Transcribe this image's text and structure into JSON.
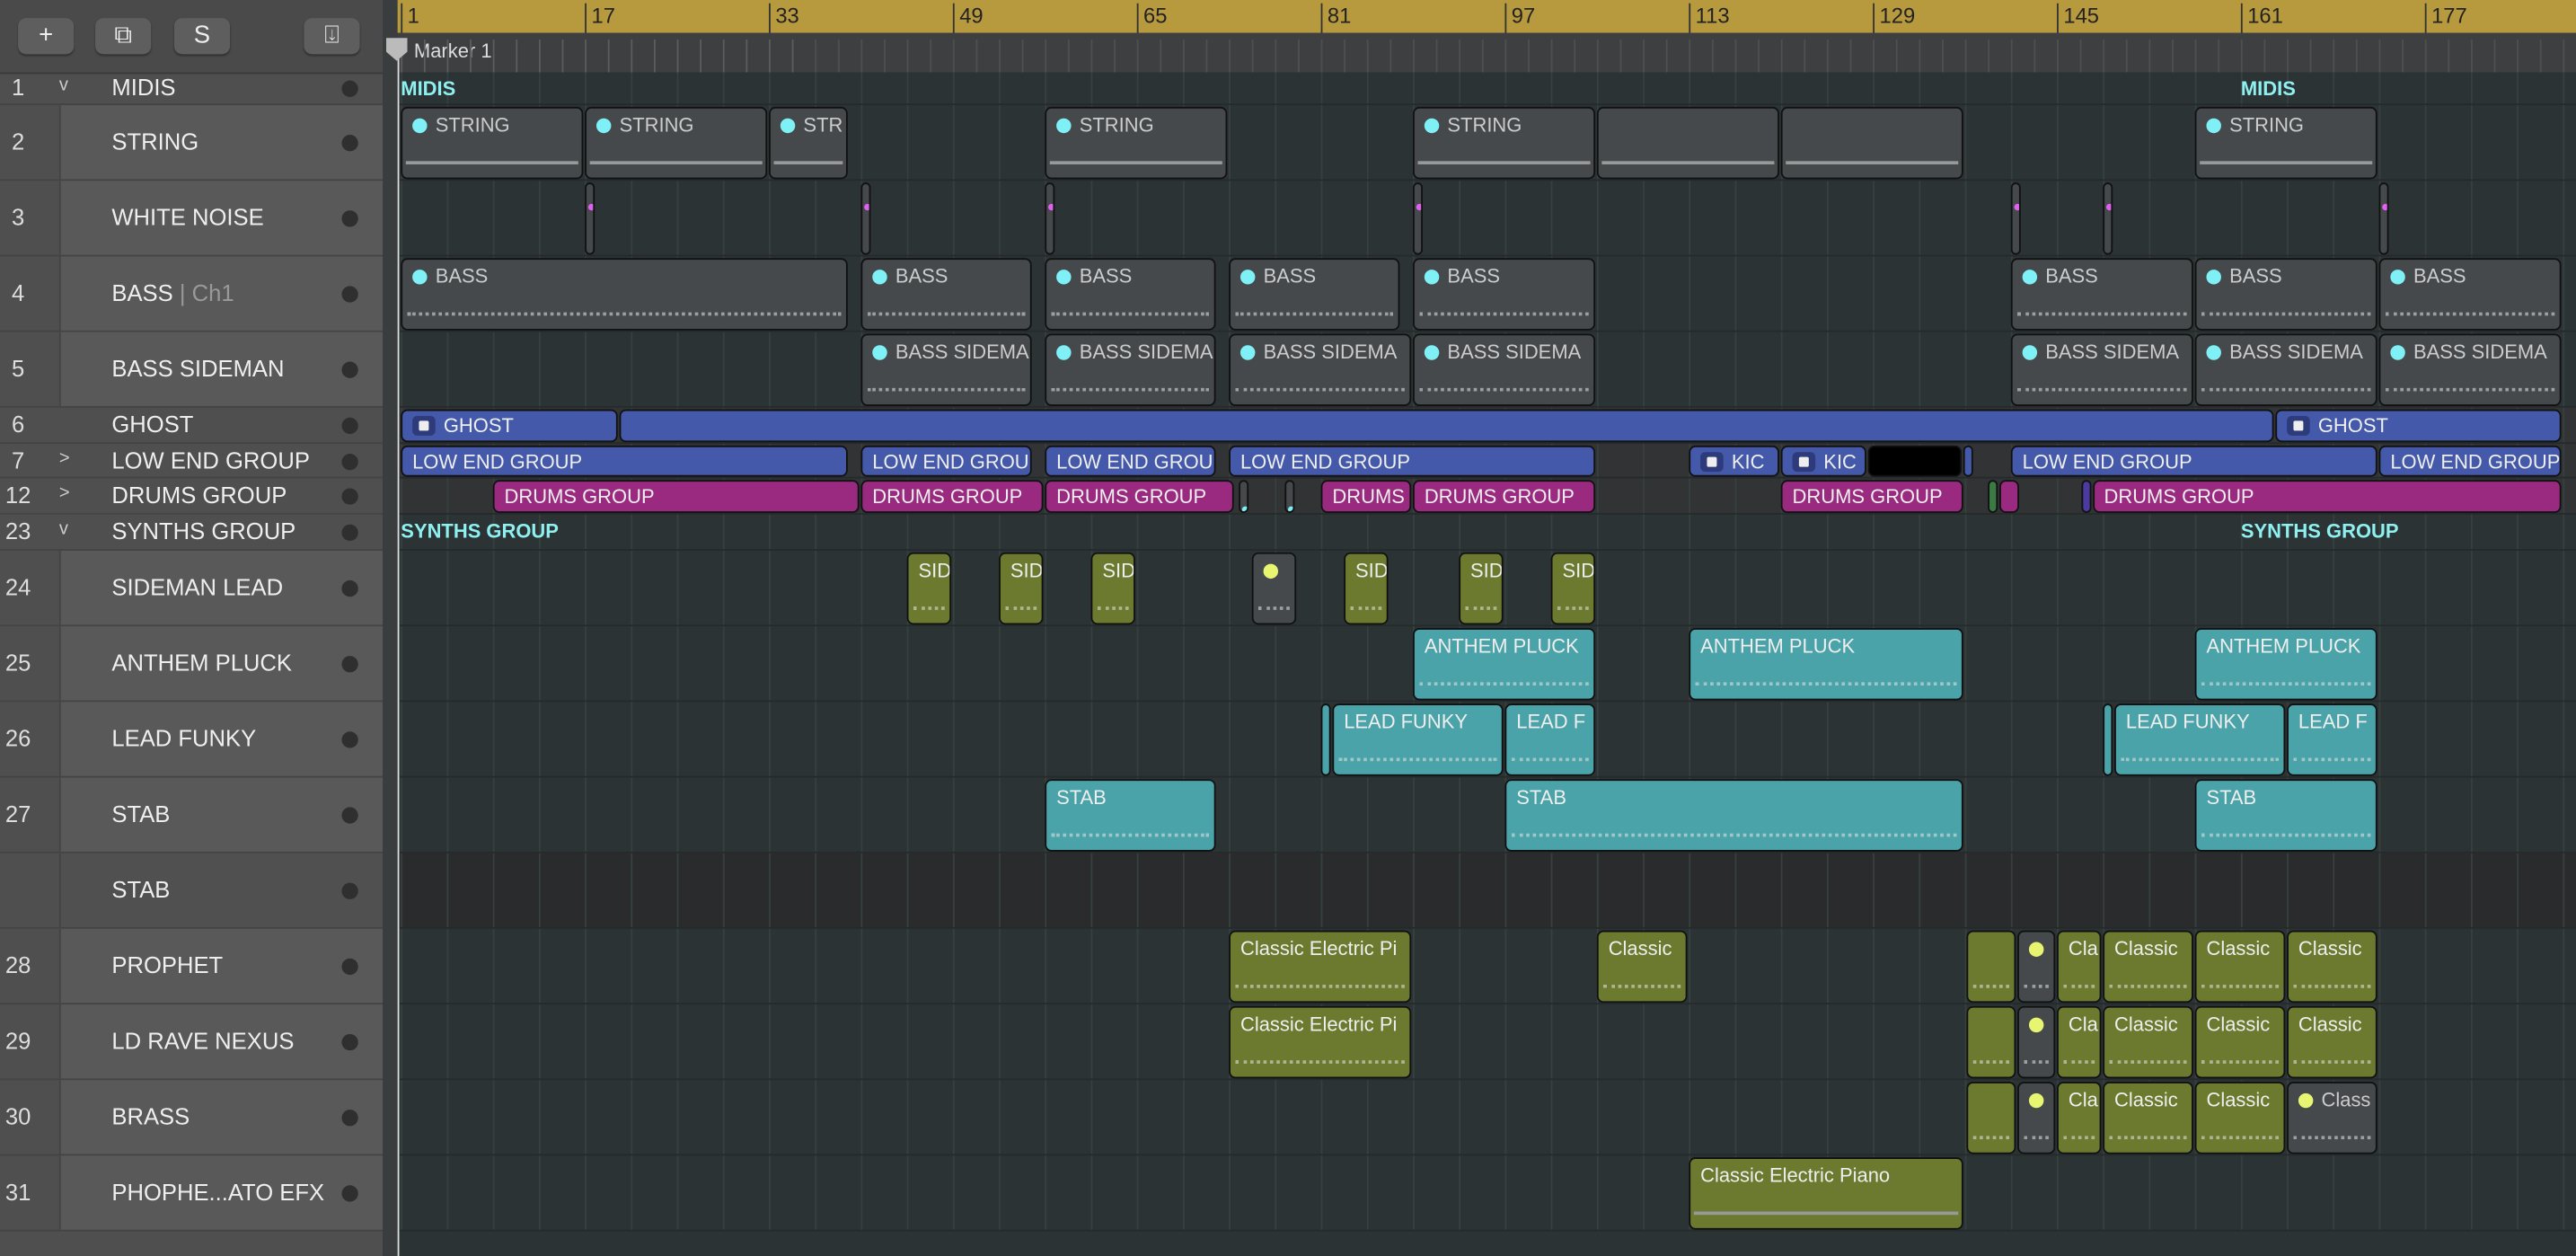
{
  "toolbar": {
    "add_label": "+",
    "duplicate_icon": "duplicate-track-icon",
    "solo_label": "S",
    "download_icon": "download-icon"
  },
  "ruler": {
    "bars": [
      "1",
      "17",
      "33",
      "49",
      "65",
      "81",
      "97",
      "113",
      "129",
      "145",
      "161",
      "177"
    ],
    "marker": "Marker 1"
  },
  "colors": {
    "teal": "#4aa3a8",
    "olive": "#6b7a2e",
    "blue": "#4459a9",
    "magenta": "#9a2a80",
    "gray": "#45494c",
    "black": "#000000",
    "green": "#3c7a45",
    "purple": "#4b3aa0",
    "cyan_dot": "#7ff0f5",
    "yellow_dot": "#e8f570",
    "pink_dot": "#e060f0"
  },
  "tracks": [
    {
      "num": "1",
      "name": "MIDIS",
      "chev": "v",
      "type": "group"
    },
    {
      "num": "2",
      "name": "STRING"
    },
    {
      "num": "3",
      "name": "WHITE NOISE"
    },
    {
      "num": "4",
      "name": "BASS",
      "sub": "| Ch1"
    },
    {
      "num": "5",
      "name": "BASS SIDEMAN"
    },
    {
      "num": "6",
      "name": "GHOST",
      "type": "small"
    },
    {
      "num": "7",
      "name": "LOW END GROUP",
      "chev": ">",
      "type": "small"
    },
    {
      "num": "12",
      "name": "DRUMS GROUP",
      "chev": ">",
      "type": "small"
    },
    {
      "num": "23",
      "name": "SYNTHS GROUP",
      "chev": "v",
      "type": "group"
    },
    {
      "num": "24",
      "name": "SIDEMAN LEAD"
    },
    {
      "num": "25",
      "name": "ANTHEM PLUCK"
    },
    {
      "num": "26",
      "name": "LEAD FUNKY"
    },
    {
      "num": "27",
      "name": "STAB"
    },
    {
      "num": "",
      "name": "STAB",
      "dark": true
    },
    {
      "num": "28",
      "name": "PROPHET"
    },
    {
      "num": "29",
      "name": "LD RAVE NEXUS"
    },
    {
      "num": "30",
      "name": "BRASS"
    },
    {
      "num": "31",
      "name": "PHOPHE...ATO EFX"
    }
  ],
  "group_labels": [
    {
      "lane": 0,
      "bar": 1,
      "text": "MIDIS"
    },
    {
      "lane": 0,
      "bar": 161,
      "text": "MIDIS"
    },
    {
      "lane": 8,
      "bar": 1,
      "text": "SYNTHS GROUP"
    },
    {
      "lane": 8,
      "bar": 161,
      "text": "SYNTHS GROUP"
    }
  ],
  "regions": [
    {
      "lane": 1,
      "items": [
        [
          1,
          17,
          "STRING",
          "gray",
          "cd"
        ],
        [
          17,
          33,
          "STRING",
          "gray",
          "cd"
        ],
        [
          33,
          40,
          "STR",
          "gray",
          "cd"
        ],
        [
          57,
          73,
          "STRING",
          "gray",
          "cd"
        ],
        [
          89,
          105,
          "STRING",
          "gray",
          "cd"
        ],
        [
          105,
          121,
          "",
          "gray",
          "l"
        ],
        [
          121,
          137,
          "",
          "gray",
          "l"
        ],
        [
          157,
          173,
          "STRING",
          "gray",
          "cd"
        ]
      ]
    },
    {
      "lane": 2,
      "items": [
        [
          17,
          18,
          "",
          "gray",
          "p"
        ],
        [
          41,
          42,
          "",
          "gray",
          "p"
        ],
        [
          57,
          58,
          "",
          "gray",
          "p"
        ],
        [
          89,
          90,
          "",
          "gray",
          "p"
        ],
        [
          141,
          142,
          "",
          "gray",
          "p"
        ],
        [
          149,
          150,
          "",
          "gray",
          "p"
        ],
        [
          173,
          174,
          "",
          "gray",
          "p"
        ]
      ]
    },
    {
      "lane": 3,
      "items": [
        [
          1,
          40,
          "BASS",
          "gray",
          "cn"
        ],
        [
          41,
          56,
          "BASS",
          "gray",
          "cn"
        ],
        [
          57,
          72,
          "BASS",
          "gray",
          "cn"
        ],
        [
          73,
          88,
          "BASS",
          "gray",
          "cn"
        ],
        [
          89,
          105,
          "BASS",
          "gray",
          "cn"
        ],
        [
          141,
          157,
          "BASS",
          "gray",
          "cn"
        ],
        [
          157,
          173,
          "BASS",
          "gray",
          "cn"
        ],
        [
          173,
          189,
          "BASS",
          "gray",
          "cn"
        ]
      ]
    },
    {
      "lane": 4,
      "items": [
        [
          41,
          56,
          "BASS SIDEMA",
          "gray",
          "cn"
        ],
        [
          57,
          72,
          "BASS SIDEMA",
          "gray",
          "cn"
        ],
        [
          73,
          89,
          "BASS SIDEMA",
          "gray",
          "cn"
        ],
        [
          89,
          105,
          "BASS SIDEMA",
          "gray",
          "cn"
        ],
        [
          141,
          157,
          "BASS SIDEMA",
          "gray",
          "cn"
        ],
        [
          157,
          173,
          "BASS SIDEMA",
          "gray",
          "cn"
        ],
        [
          173,
          189,
          "BASS SIDEMA",
          "gray",
          "cn"
        ]
      ]
    },
    {
      "lane": 5,
      "items": [
        [
          1,
          20,
          "GHOST",
          "blue",
          "f"
        ],
        [
          20,
          164,
          "",
          "blue",
          ""
        ],
        [
          164,
          189,
          "GHOST",
          "blue",
          "f"
        ]
      ]
    },
    {
      "lane": 6,
      "items": [
        [
          1,
          40,
          "LOW END GROUP",
          "blue",
          ""
        ],
        [
          41,
          56,
          "LOW END GROU",
          "blue",
          ""
        ],
        [
          57,
          72,
          "LOW END GROU",
          "blue",
          ""
        ],
        [
          73,
          105,
          "LOW END GROUP",
          "blue",
          ""
        ],
        [
          113,
          121,
          "KIC",
          "blue",
          "f"
        ],
        [
          121,
          128.6,
          "KIC",
          "blue",
          "f"
        ],
        [
          128.6,
          136.8,
          "",
          "black",
          ""
        ],
        [
          136.8,
          137.8,
          "",
          "blue",
          ""
        ],
        [
          141,
          173,
          "LOW END GROUP",
          "blue",
          ""
        ],
        [
          173,
          189,
          "LOW END GROUP",
          "blue",
          ""
        ]
      ]
    },
    {
      "lane": 7,
      "items": [
        [
          9,
          41,
          "DRUMS GROUP",
          "magenta",
          ""
        ],
        [
          41,
          57,
          "DRUMS GROUP",
          "magenta",
          ""
        ],
        [
          57,
          73.6,
          "DRUMS GROUP",
          "magenta",
          ""
        ],
        [
          73.9,
          74.9,
          "",
          "gray",
          "q"
        ],
        [
          77.9,
          78.9,
          "",
          "gray",
          "q"
        ],
        [
          81,
          89,
          "DRUMS",
          "magenta",
          ""
        ],
        [
          89,
          105,
          "DRUMS GROUP",
          "magenta",
          ""
        ],
        [
          121,
          137,
          "DRUMS GROUP",
          "magenta",
          ""
        ],
        [
          139,
          140,
          "",
          "green",
          ""
        ],
        [
          140,
          141.9,
          "",
          "magenta",
          ""
        ],
        [
          147.2,
          148.1,
          "",
          "purple",
          ""
        ],
        [
          148.1,
          189,
          "DRUMS GROUP",
          "magenta",
          ""
        ]
      ]
    },
    {
      "lane": 9,
      "items": [
        [
          45,
          49,
          "SID",
          "olive",
          "n"
        ],
        [
          53,
          57,
          "SID",
          "olive",
          "n"
        ],
        [
          61,
          65,
          "SID",
          "olive",
          "n"
        ],
        [
          75,
          79,
          "",
          "gray",
          "yn"
        ],
        [
          83,
          87,
          "SID",
          "olive",
          "n"
        ],
        [
          93,
          97,
          "SID",
          "olive",
          "n"
        ],
        [
          101,
          105,
          "SID",
          "olive",
          "n"
        ]
      ]
    },
    {
      "lane": 10,
      "items": [
        [
          89,
          105,
          "ANTHEM PLUCK",
          "teal",
          "n"
        ],
        [
          113,
          137,
          "ANTHEM PLUCK",
          "teal",
          "n"
        ],
        [
          157,
          173,
          "ANTHEM PLUCK",
          "teal",
          "n"
        ]
      ]
    },
    {
      "lane": 11,
      "items": [
        [
          81,
          82,
          "",
          "teal",
          ""
        ],
        [
          82,
          97,
          "LEAD FUNKY",
          "teal",
          "n"
        ],
        [
          97,
          105,
          "LEAD F",
          "teal",
          "n"
        ],
        [
          149,
          150,
          "",
          "teal",
          ""
        ],
        [
          150,
          165,
          "LEAD FUNKY",
          "teal",
          "n"
        ],
        [
          165,
          173,
          "LEAD F",
          "teal",
          "n"
        ]
      ]
    },
    {
      "lane": 12,
      "items": [
        [
          57,
          72,
          "STAB",
          "teal",
          "n"
        ],
        [
          97,
          137,
          "STAB",
          "teal",
          "n"
        ],
        [
          157,
          173,
          "STAB",
          "teal",
          "n"
        ]
      ]
    },
    {
      "lane": 14,
      "items": [
        [
          73,
          89,
          "Classic Electric Pi",
          "olive",
          "n"
        ],
        [
          105,
          113,
          "Classic",
          "olive",
          "n"
        ],
        [
          137.1,
          141.6,
          "",
          "olive",
          "n"
        ],
        [
          141.6,
          145,
          "",
          "gray",
          "yn"
        ],
        [
          145,
          149,
          "Cla",
          "olive",
          "n"
        ],
        [
          149,
          157,
          "Classic",
          "olive",
          "n"
        ],
        [
          157,
          165,
          "Classic",
          "olive",
          "n"
        ],
        [
          165,
          173,
          "Classic",
          "olive",
          "n"
        ]
      ]
    },
    {
      "lane": 15,
      "items": [
        [
          73,
          89,
          "Classic Electric Pi",
          "olive",
          "n"
        ],
        [
          137.1,
          141.6,
          "",
          "olive",
          "n"
        ],
        [
          141.6,
          145,
          "",
          "gray",
          "yn"
        ],
        [
          145,
          149,
          "Cla",
          "olive",
          "n"
        ],
        [
          149,
          157,
          "Classic",
          "olive",
          "n"
        ],
        [
          157,
          165,
          "Classic",
          "olive",
          "n"
        ],
        [
          165,
          173,
          "Classic",
          "olive",
          "n"
        ]
      ]
    },
    {
      "lane": 16,
      "items": [
        [
          137.1,
          141.6,
          "",
          "olive",
          "n"
        ],
        [
          141.6,
          145,
          "",
          "gray",
          "yn"
        ],
        [
          145,
          149,
          "Cla",
          "olive",
          "n"
        ],
        [
          149,
          157,
          "Classic",
          "olive",
          "n"
        ],
        [
          157,
          165,
          "Classic",
          "olive",
          "n"
        ],
        [
          165,
          173,
          "Class",
          "gray",
          "yn"
        ]
      ]
    },
    {
      "lane": 17,
      "items": [
        [
          113,
          137,
          "Classic Electric Piano",
          "olive",
          "l"
        ]
      ]
    }
  ]
}
